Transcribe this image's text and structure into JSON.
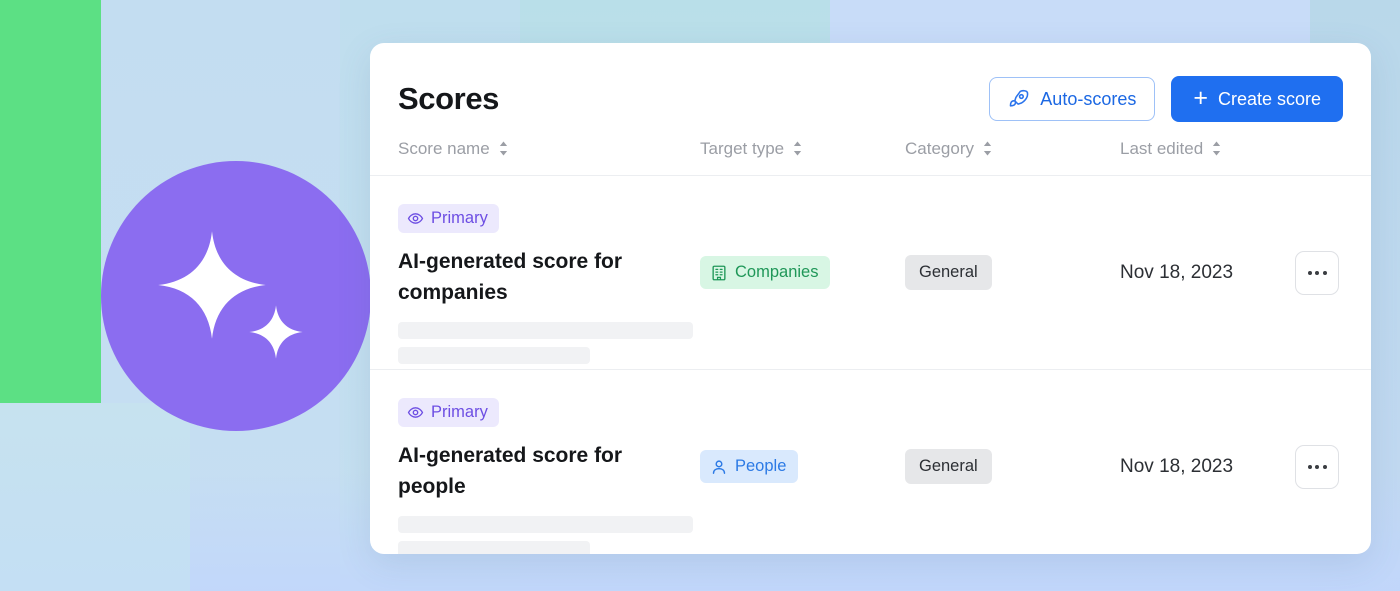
{
  "background": {
    "green_block_color": "#5ce084",
    "circle_color": "#8b6df0",
    "sparkle_icon": "sparkles-icon",
    "base_color": "#c5dcf5"
  },
  "card": {
    "title": "Scores",
    "actions": {
      "auto_scores_label": "Auto-scores",
      "auto_scores_icon": "rocket-icon",
      "create_score_label": "Create score",
      "create_score_icon": "plus-icon",
      "primary_color": "#1f6ff0",
      "secondary_text_color": "#1c68e3"
    },
    "table": {
      "columns": [
        {
          "label": "Score name",
          "sortable": true
        },
        {
          "label": "Target type",
          "sortable": true
        },
        {
          "label": "Category",
          "sortable": true
        },
        {
          "label": "Last edited",
          "sortable": true
        },
        {
          "label": "",
          "sortable": false
        }
      ],
      "rows": [
        {
          "badge": {
            "label": "Primary",
            "icon": "eye-icon",
            "color": "#6d4ee3"
          },
          "name": "AI-generated score for companies",
          "target_type": {
            "label": "Companies",
            "icon": "building-icon",
            "color": "#1f9758"
          },
          "category": "General",
          "last_edited": "Nov 18, 2023",
          "menu_icon": "ellipsis-icon"
        },
        {
          "badge": {
            "label": "Primary",
            "icon": "eye-icon",
            "color": "#6d4ee3"
          },
          "name": "AI-generated score for people",
          "target_type": {
            "label": "People",
            "icon": "person-icon",
            "color": "#2c7ae5"
          },
          "category": "General",
          "last_edited": "Nov 18, 2023",
          "menu_icon": "ellipsis-icon"
        }
      ]
    }
  }
}
